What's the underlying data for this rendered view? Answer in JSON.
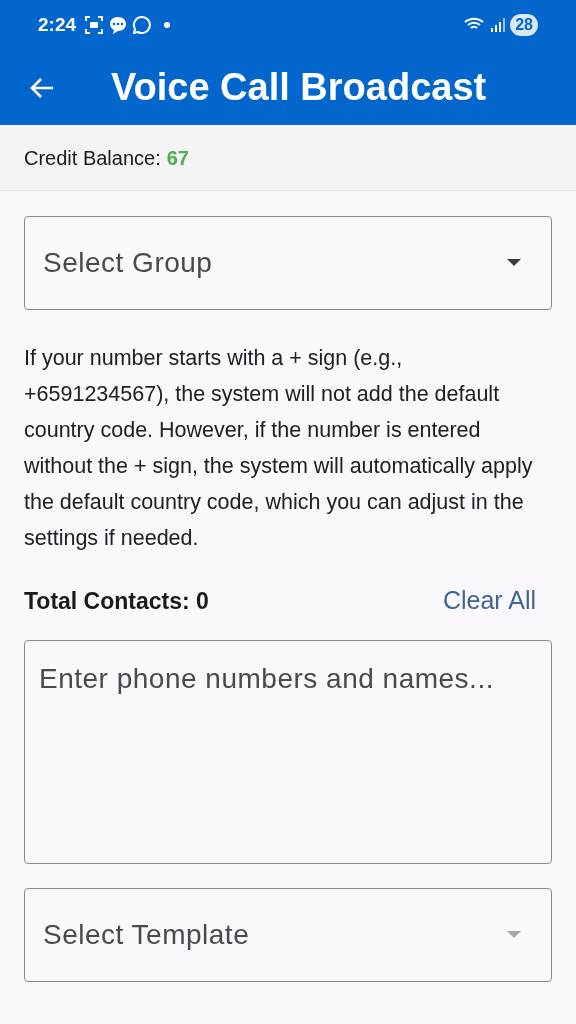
{
  "status_bar": {
    "time": "2:24",
    "battery": "28"
  },
  "app_bar": {
    "title": "Voice Call Broadcast"
  },
  "credit": {
    "label": "Credit Balance:",
    "value": "67"
  },
  "group_select": {
    "placeholder": "Select Group",
    "disabled": false
  },
  "info_text": "If your number starts with a + sign (e.g., +6591234567), the system will not add the default country code. However, if the number is entered without the + sign, the system will automatically apply the default country code, which you can adjust in the settings if needed.",
  "contacts": {
    "total": "Total Contacts: 0",
    "clear": "Clear All",
    "placeholder": "Enter phone numbers and names..."
  },
  "template_select": {
    "placeholder": "Select Template",
    "disabled": true
  }
}
